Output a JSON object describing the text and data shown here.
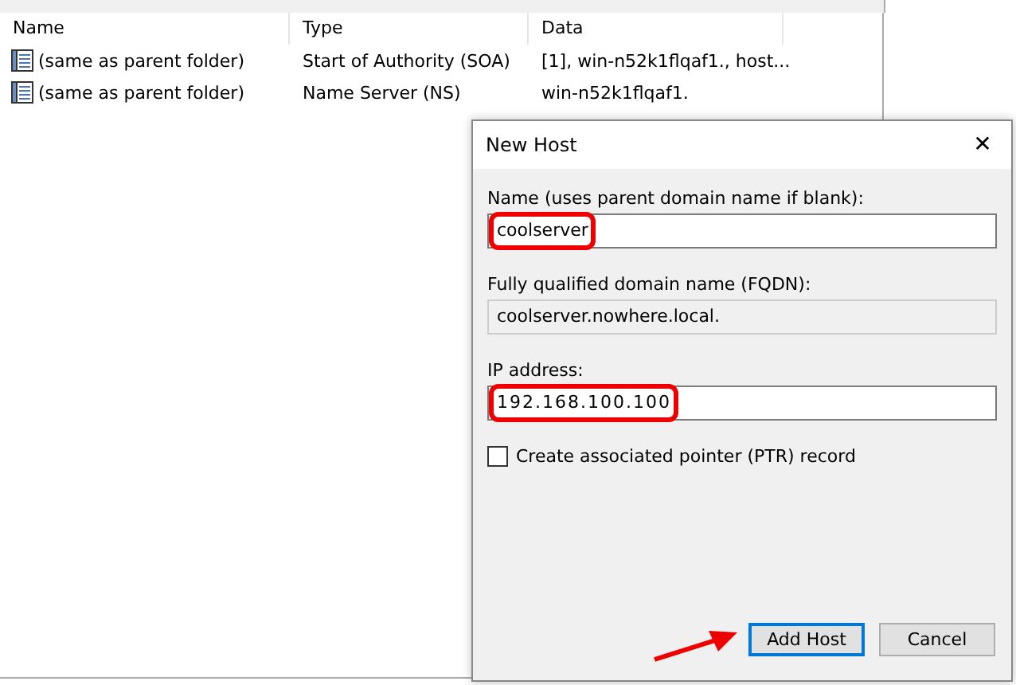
{
  "list": {
    "columns": [
      "Name",
      "Type",
      "Data"
    ],
    "rows": [
      {
        "name": "(same as parent folder)",
        "type": "Start of Authority (SOA)",
        "data": "[1], win-n52k1flqaf1., host..."
      },
      {
        "name": "(same as parent folder)",
        "type": "Name Server (NS)",
        "data": "win-n52k1flqaf1."
      }
    ]
  },
  "dialog": {
    "title": "New Host",
    "close": "✕",
    "name_label": "Name (uses parent domain name if blank):",
    "name_value": "coolserver",
    "name_highlighted": true,
    "fqdn_label": "Fully qualified domain name (FQDN):",
    "fqdn_value": "coolserver.nowhere.local.",
    "ip_label": "IP address:",
    "ip_value": "192.168.100.100",
    "ip_highlighted": true,
    "ptr": {
      "label": "Create associated pointer (PTR) record",
      "checked": false
    },
    "buttons": [
      {
        "label": "Add Host",
        "default": true,
        "pointed": true
      },
      {
        "label": "Cancel",
        "default": false,
        "pointed": false
      }
    ]
  }
}
